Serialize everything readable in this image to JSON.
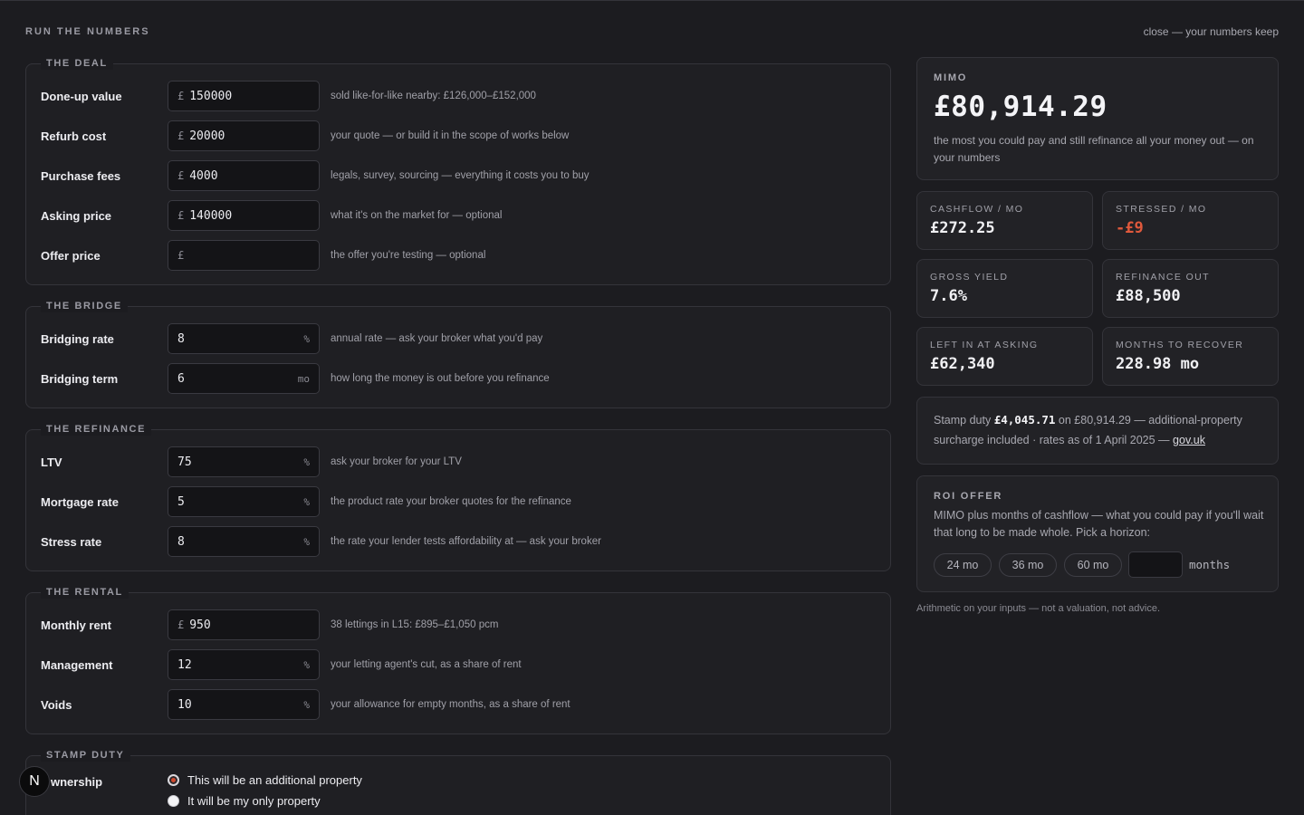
{
  "header": {
    "title": "RUN THE NUMBERS",
    "close_label": "close — your numbers keep"
  },
  "deal": {
    "legend": "THE DEAL",
    "rows": [
      {
        "label": "Done-up value",
        "prefix": "£",
        "value": "150000",
        "hint": "sold like-for-like nearby: £126,000–£152,000"
      },
      {
        "label": "Refurb cost",
        "prefix": "£",
        "value": "20000",
        "hint": "your quote — or build it in the scope of works below"
      },
      {
        "label": "Purchase fees",
        "prefix": "£",
        "value": "4000",
        "hint": "legals, survey, sourcing — everything it costs you to buy"
      },
      {
        "label": "Asking price",
        "prefix": "£",
        "value": "140000",
        "hint": "what it's on the market for — optional"
      },
      {
        "label": "Offer price",
        "prefix": "£",
        "value": "",
        "hint": "the offer you're testing — optional"
      }
    ]
  },
  "bridge": {
    "legend": "THE BRIDGE",
    "rows": [
      {
        "label": "Bridging rate",
        "value": "8",
        "suffix": "%",
        "hint": "annual rate — ask your broker what you'd pay"
      },
      {
        "label": "Bridging term",
        "value": "6",
        "suffix": "mo",
        "hint": "how long the money is out before you refinance"
      }
    ]
  },
  "refinance": {
    "legend": "THE REFINANCE",
    "rows": [
      {
        "label": "LTV",
        "value": "75",
        "suffix": "%",
        "hint": "ask your broker for your LTV"
      },
      {
        "label": "Mortgage rate",
        "value": "5",
        "suffix": "%",
        "hint": "the product rate your broker quotes for the refinance"
      },
      {
        "label": "Stress rate",
        "value": "8",
        "suffix": "%",
        "hint": "the rate your lender tests affordability at — ask your broker"
      }
    ]
  },
  "rental": {
    "legend": "THE RENTAL",
    "rows": [
      {
        "label": "Monthly rent",
        "prefix": "£",
        "value": "950",
        "hint": "38 lettings in L15: £895–£1,050 pcm"
      },
      {
        "label": "Management",
        "value": "12",
        "suffix": "%",
        "hint": "your letting agent's cut, as a share of rent"
      },
      {
        "label": "Voids",
        "value": "10",
        "suffix": "%",
        "hint": "your allowance for empty months, as a share of rent"
      }
    ]
  },
  "stamp": {
    "legend": "STAMP DUTY",
    "label": "wnership",
    "options": [
      "This will be an additional property",
      "It will be my only property"
    ],
    "selected": 0
  },
  "mimo": {
    "label": "MIMO",
    "value": "£80,914.29",
    "desc": "the most you could pay and still refinance all your money out — on your numbers"
  },
  "stats": [
    {
      "label": "CASHFLOW / MO",
      "value": "£272.25"
    },
    {
      "label": "STRESSED / MO",
      "value": "-£9"
    },
    {
      "label": "GROSS YIELD",
      "value": "7.6%"
    },
    {
      "label": "REFINANCE OUT",
      "value": "£88,500"
    },
    {
      "label": "LEFT IN AT ASKING",
      "value": "£62,340"
    },
    {
      "label": "MONTHS TO RECOVER",
      "value": "228.98 mo"
    }
  ],
  "stamp_note": {
    "pre": "Stamp duty ",
    "amount": "£4,045.71",
    "mid": " on £80,914.29 — additional-property surcharge included · rates as of 1 April 2025 — ",
    "link": "gov.uk"
  },
  "roi": {
    "label": "ROI OFFER",
    "desc": "MIMO plus months of cashflow — what you could pay if you'll wait that long to be made whole. Pick a horizon:",
    "pills": [
      "24 mo",
      "36 mo",
      "60 mo"
    ],
    "months_value": "",
    "months_suffix": "months"
  },
  "disclaimer": "Arithmetic on your inputs — not a valuation, not advice.",
  "badge": "N",
  "colors": {
    "accent_negative": "#e0593c",
    "background": "#1c1c20"
  }
}
